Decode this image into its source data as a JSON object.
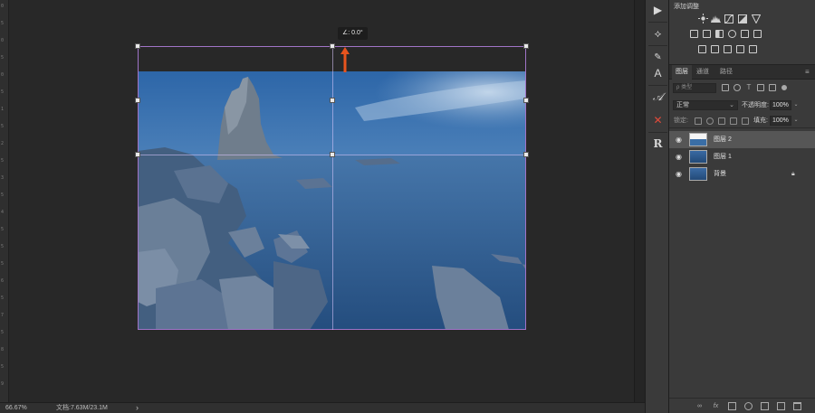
{
  "ruler": {
    "ticks": [
      "0",
      "5",
      "0",
      "5",
      "0",
      "5",
      "1",
      "5",
      "2",
      "5",
      "3",
      "5",
      "4",
      "5",
      "5",
      "5",
      "6",
      "5",
      "7",
      "5",
      "8",
      "5",
      "9"
    ]
  },
  "transform": {
    "angle_readout": "∠: 0.0°"
  },
  "status": {
    "zoom": "66.67%",
    "doc_info": "文档:7.63M/23.1M",
    "arrow": "›"
  },
  "toolstrip": {
    "tools": [
      {
        "name": "play-icon",
        "glyph": "▶"
      },
      {
        "name": "history-brush-icon",
        "glyph": "⟡"
      },
      {
        "name": "eyedropper-icon",
        "glyph": "✎"
      },
      {
        "name": "character-style-icon",
        "glyph": "A"
      },
      {
        "name": "type-paragraph-icon",
        "glyph": "𝒜"
      },
      {
        "name": "no-tool-icon",
        "glyph": "✕"
      },
      {
        "name": "resource-icon",
        "glyph": "R"
      }
    ]
  },
  "adjustments": {
    "title": "添加调整"
  },
  "layers_panel": {
    "tabs": [
      {
        "label": "图层",
        "active": true
      },
      {
        "label": "通道",
        "active": false
      },
      {
        "label": "路径",
        "active": false
      }
    ],
    "menu_icon": "≡",
    "kind_placeholder": "ρ 类型",
    "blend_mode": "正常",
    "opacity_label": "不透明度:",
    "opacity_value": "100%",
    "lock_label": "锁定:",
    "fill_label": "填充:",
    "fill_value": "100%",
    "layers": [
      {
        "name": "图层 2",
        "selected": true,
        "locked": false
      },
      {
        "name": "图层 1",
        "selected": false,
        "locked": false
      },
      {
        "name": "背景",
        "selected": false,
        "locked": true
      }
    ]
  },
  "colors": {
    "accent_arrow": "#e8541e",
    "transform_box": "#a074c7",
    "selected_layer": "#565656"
  }
}
